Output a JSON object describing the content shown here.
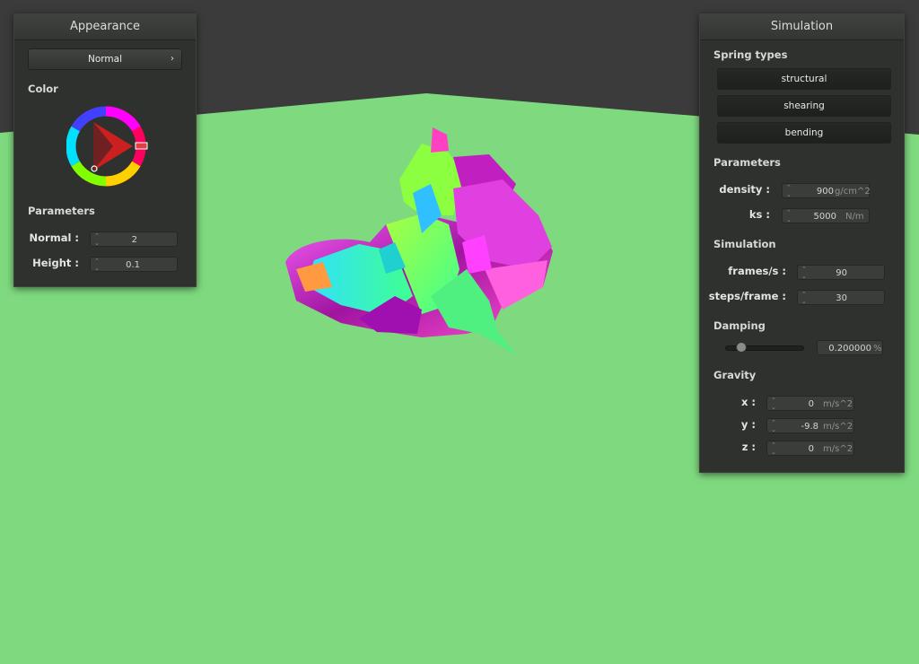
{
  "appearance": {
    "title": "Appearance",
    "mode": "Normal",
    "mode_arrow": "›",
    "color_label": "Color",
    "parameters_label": "Parameters",
    "normal_label": "Normal :",
    "normal_value": "2",
    "height_label": "Height :",
    "height_value": "0.1"
  },
  "simulation": {
    "title": "Simulation",
    "spring_types_label": "Spring types",
    "structural": "structural",
    "shearing": "shearing",
    "bending": "bending",
    "parameters_label": "Parameters",
    "density_label": "density :",
    "density_value": "900",
    "density_unit": "g/cm^2",
    "ks_label": "ks :",
    "ks_value": "5000",
    "ks_unit": "N/m",
    "simulation_label": "Simulation",
    "fps_label": "frames/s :",
    "fps_value": "90",
    "steps_label": "steps/frame :",
    "steps_value": "30",
    "damping_label": "Damping",
    "damping_value": "0.200000",
    "damping_unit": "%",
    "damping_fraction": 0.2,
    "gravity_label": "Gravity",
    "gx_label": "x :",
    "gx_value": "0",
    "gy_label": "y :",
    "gy_value": "-9.8",
    "gz_label": "z :",
    "gz_value": "0",
    "g_unit": "m/s^2"
  },
  "icons": {
    "spin": "spinner-arrows-icon",
    "popup": "chevron-right-icon"
  },
  "colors": {
    "floor": "#7fda7f",
    "sky": "#3b3b3b",
    "panel": "#2e312e",
    "accent": "#d24b4b"
  }
}
